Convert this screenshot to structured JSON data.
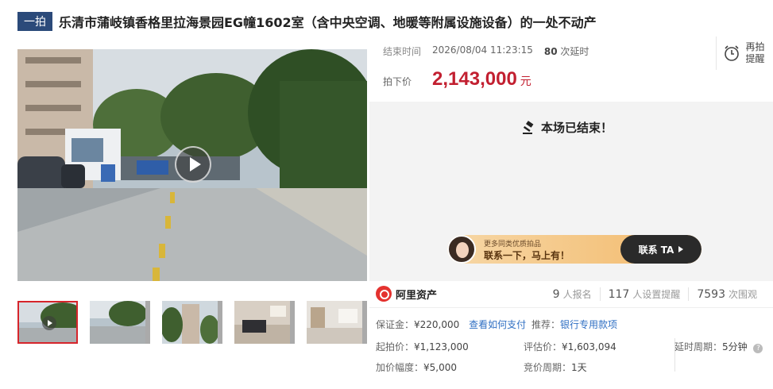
{
  "header": {
    "badge": "一拍",
    "title": "乐清市蒲岐镇香格里拉海景园EG幢1602室（含中央空调、地暖等附属设施设备）的一处不动产"
  },
  "auction": {
    "end_label": "结束时间",
    "end_time": "2026/08/04 11:23:15",
    "delays_count": "80",
    "delays_label": "次延时",
    "price_label": "拍下价",
    "price": "2,143,000",
    "price_unit": "元",
    "remind_label_1": "再拍",
    "remind_label_2": "提醒",
    "ended_message": "本场已结束！"
  },
  "contact_banner": {
    "small_text": "更多同类优质拍品",
    "big_text": "联系一下，马上有！",
    "button_label": "联系 TA"
  },
  "brand": {
    "name": "阿里资产"
  },
  "stats": [
    {
      "count": "9",
      "label": "人报名"
    },
    {
      "count": "117",
      "label": "人设置提醒"
    },
    {
      "count": "7593",
      "label": "次围观"
    }
  ],
  "details": {
    "deposit_label": "保证金：",
    "deposit_value": "¥220,000",
    "payment_link": "查看如何支付",
    "recommend_label": "推荐：",
    "recommend_link": "银行专用款项",
    "start_price_label": "起拍价：",
    "start_price_value": "¥1,123,000",
    "appraisal_label": "评估价：",
    "appraisal_value": "¥1,603,094",
    "delay_cycle_label": "延时周期：",
    "delay_cycle_value": "5分钟",
    "increment_label": "加价幅度：",
    "increment_value": "¥5,000",
    "bid_cycle_label": "竞价周期：",
    "bid_cycle_value": "1天"
  },
  "colors": {
    "badge_bg": "#2b4a7a",
    "price": "#c21f30",
    "link": "#2f6fc3",
    "brand_red": "#e4322f"
  }
}
